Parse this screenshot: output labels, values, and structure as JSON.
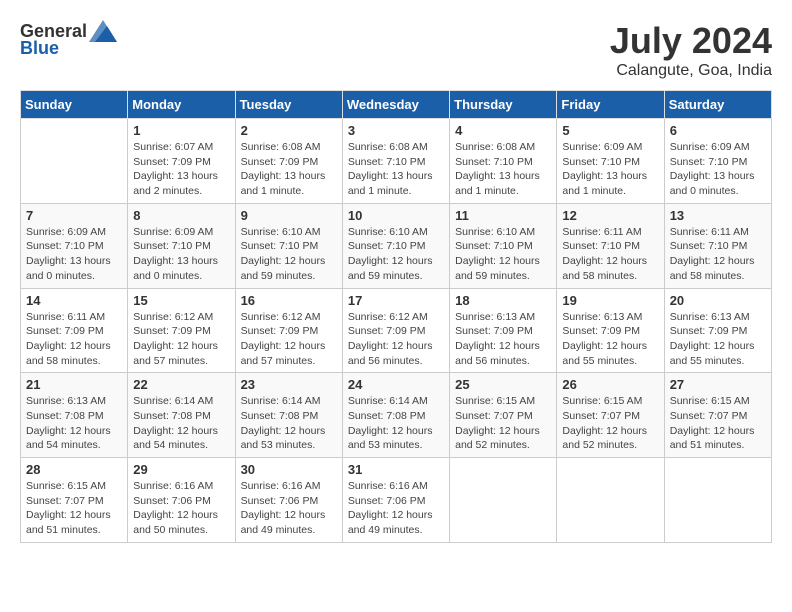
{
  "header": {
    "logo_general": "General",
    "logo_blue": "Blue",
    "month_year": "July 2024",
    "location": "Calangute, Goa, India"
  },
  "weekdays": [
    "Sunday",
    "Monday",
    "Tuesday",
    "Wednesday",
    "Thursday",
    "Friday",
    "Saturday"
  ],
  "weeks": [
    [
      {
        "day": "",
        "info": ""
      },
      {
        "day": "1",
        "info": "Sunrise: 6:07 AM\nSunset: 7:09 PM\nDaylight: 13 hours\nand 2 minutes."
      },
      {
        "day": "2",
        "info": "Sunrise: 6:08 AM\nSunset: 7:09 PM\nDaylight: 13 hours\nand 1 minute."
      },
      {
        "day": "3",
        "info": "Sunrise: 6:08 AM\nSunset: 7:10 PM\nDaylight: 13 hours\nand 1 minute."
      },
      {
        "day": "4",
        "info": "Sunrise: 6:08 AM\nSunset: 7:10 PM\nDaylight: 13 hours\nand 1 minute."
      },
      {
        "day": "5",
        "info": "Sunrise: 6:09 AM\nSunset: 7:10 PM\nDaylight: 13 hours\nand 1 minute."
      },
      {
        "day": "6",
        "info": "Sunrise: 6:09 AM\nSunset: 7:10 PM\nDaylight: 13 hours\nand 0 minutes."
      }
    ],
    [
      {
        "day": "7",
        "info": "Sunrise: 6:09 AM\nSunset: 7:10 PM\nDaylight: 13 hours\nand 0 minutes."
      },
      {
        "day": "8",
        "info": "Sunrise: 6:09 AM\nSunset: 7:10 PM\nDaylight: 13 hours\nand 0 minutes."
      },
      {
        "day": "9",
        "info": "Sunrise: 6:10 AM\nSunset: 7:10 PM\nDaylight: 12 hours\nand 59 minutes."
      },
      {
        "day": "10",
        "info": "Sunrise: 6:10 AM\nSunset: 7:10 PM\nDaylight: 12 hours\nand 59 minutes."
      },
      {
        "day": "11",
        "info": "Sunrise: 6:10 AM\nSunset: 7:10 PM\nDaylight: 12 hours\nand 59 minutes."
      },
      {
        "day": "12",
        "info": "Sunrise: 6:11 AM\nSunset: 7:10 PM\nDaylight: 12 hours\nand 58 minutes."
      },
      {
        "day": "13",
        "info": "Sunrise: 6:11 AM\nSunset: 7:10 PM\nDaylight: 12 hours\nand 58 minutes."
      }
    ],
    [
      {
        "day": "14",
        "info": "Sunrise: 6:11 AM\nSunset: 7:09 PM\nDaylight: 12 hours\nand 58 minutes."
      },
      {
        "day": "15",
        "info": "Sunrise: 6:12 AM\nSunset: 7:09 PM\nDaylight: 12 hours\nand 57 minutes."
      },
      {
        "day": "16",
        "info": "Sunrise: 6:12 AM\nSunset: 7:09 PM\nDaylight: 12 hours\nand 57 minutes."
      },
      {
        "day": "17",
        "info": "Sunrise: 6:12 AM\nSunset: 7:09 PM\nDaylight: 12 hours\nand 56 minutes."
      },
      {
        "day": "18",
        "info": "Sunrise: 6:13 AM\nSunset: 7:09 PM\nDaylight: 12 hours\nand 56 minutes."
      },
      {
        "day": "19",
        "info": "Sunrise: 6:13 AM\nSunset: 7:09 PM\nDaylight: 12 hours\nand 55 minutes."
      },
      {
        "day": "20",
        "info": "Sunrise: 6:13 AM\nSunset: 7:09 PM\nDaylight: 12 hours\nand 55 minutes."
      }
    ],
    [
      {
        "day": "21",
        "info": "Sunrise: 6:13 AM\nSunset: 7:08 PM\nDaylight: 12 hours\nand 54 minutes."
      },
      {
        "day": "22",
        "info": "Sunrise: 6:14 AM\nSunset: 7:08 PM\nDaylight: 12 hours\nand 54 minutes."
      },
      {
        "day": "23",
        "info": "Sunrise: 6:14 AM\nSunset: 7:08 PM\nDaylight: 12 hours\nand 53 minutes."
      },
      {
        "day": "24",
        "info": "Sunrise: 6:14 AM\nSunset: 7:08 PM\nDaylight: 12 hours\nand 53 minutes."
      },
      {
        "day": "25",
        "info": "Sunrise: 6:15 AM\nSunset: 7:07 PM\nDaylight: 12 hours\nand 52 minutes."
      },
      {
        "day": "26",
        "info": "Sunrise: 6:15 AM\nSunset: 7:07 PM\nDaylight: 12 hours\nand 52 minutes."
      },
      {
        "day": "27",
        "info": "Sunrise: 6:15 AM\nSunset: 7:07 PM\nDaylight: 12 hours\nand 51 minutes."
      }
    ],
    [
      {
        "day": "28",
        "info": "Sunrise: 6:15 AM\nSunset: 7:07 PM\nDaylight: 12 hours\nand 51 minutes."
      },
      {
        "day": "29",
        "info": "Sunrise: 6:16 AM\nSunset: 7:06 PM\nDaylight: 12 hours\nand 50 minutes."
      },
      {
        "day": "30",
        "info": "Sunrise: 6:16 AM\nSunset: 7:06 PM\nDaylight: 12 hours\nand 49 minutes."
      },
      {
        "day": "31",
        "info": "Sunrise: 6:16 AM\nSunset: 7:06 PM\nDaylight: 12 hours\nand 49 minutes."
      },
      {
        "day": "",
        "info": ""
      },
      {
        "day": "",
        "info": ""
      },
      {
        "day": "",
        "info": ""
      }
    ]
  ]
}
